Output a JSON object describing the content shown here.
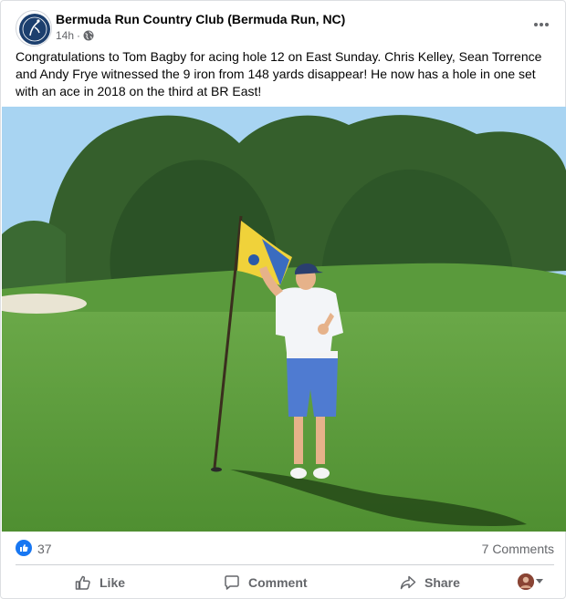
{
  "post": {
    "page_name": "Bermuda Run Country Club (Bermuda Run, NC)",
    "timestamp": "14h",
    "separator": "·",
    "audience_icon": "globe-icon",
    "text": "Congratulations to Tom Bagby for acing hole 12 on East Sunday.  Chris Kelley, Sean Torrence and Andy Frye witnessed the 9 iron from 148 yards disappear!  He now has a hole in one set with an ace in 2018 on the third at BR East!"
  },
  "stats": {
    "reaction_icon": "like-reaction-icon",
    "reaction_count": "37",
    "comments_label": "7 Comments"
  },
  "actions": {
    "like_label": "Like",
    "comment_label": "Comment",
    "share_label": "Share"
  },
  "colors": {
    "facebook_blue": "#1877f2",
    "secondary_text": "#65676b",
    "grass": "#5e9a3a",
    "sky": "#a8d4f2",
    "shorts": "#4f7bd1",
    "flag": "#f0d23a"
  }
}
